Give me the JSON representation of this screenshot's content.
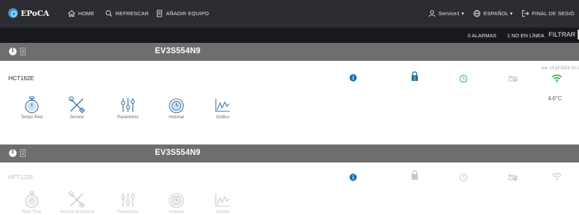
{
  "app": {
    "brand": "EPoCA"
  },
  "nav": {
    "home": "HOME",
    "refresh": "REFRESCAR",
    "add_device": "AÑADIR EQUIPO",
    "user": "Service1 ▾",
    "language": "ESPAÑOL ▾",
    "logout": "FINAL DE SESIÓ"
  },
  "subbar": {
    "alarms": "0  ALARMAS",
    "online": "1  NO EN LÍNEA",
    "filter": "FILTRAR"
  },
  "devices": [
    {
      "serial": "EV3S554N9",
      "model": "HCT162E",
      "timestamp": "jue, 13 jul 2023 10:1",
      "temperature": "4.6°C",
      "active": true,
      "tiles": [
        "Temps Réel",
        "Service",
        "Paramètres",
        "Historial",
        "Gráfico"
      ],
      "status_icons": [
        "info-icon",
        "lock-icon",
        "clock-icon",
        "camera-off-icon",
        "wifi-icon"
      ]
    },
    {
      "serial": "EV3S554N9",
      "model": "HFT122E",
      "active": false,
      "tiles": [
        "Real Time",
        "Servicio asistencia",
        "Parámetros",
        "Historial",
        "Gráfico"
      ],
      "status_icons": [
        "info-icon",
        "lock-icon",
        "clock-icon",
        "camera-off-icon",
        "wifi-icon"
      ]
    }
  ],
  "colors": {
    "topbar": "#2c2d33",
    "subbar": "#18191d",
    "card_header": "#6e6e6e",
    "info_blue": "#1f6ea0",
    "lock_blue": "#1f6ea0",
    "clock_green": "#3aae6a",
    "wifi_green": "#1ea845",
    "tile_blue": "#2e6ea6",
    "disabled_gray": "#c8c8c8"
  }
}
